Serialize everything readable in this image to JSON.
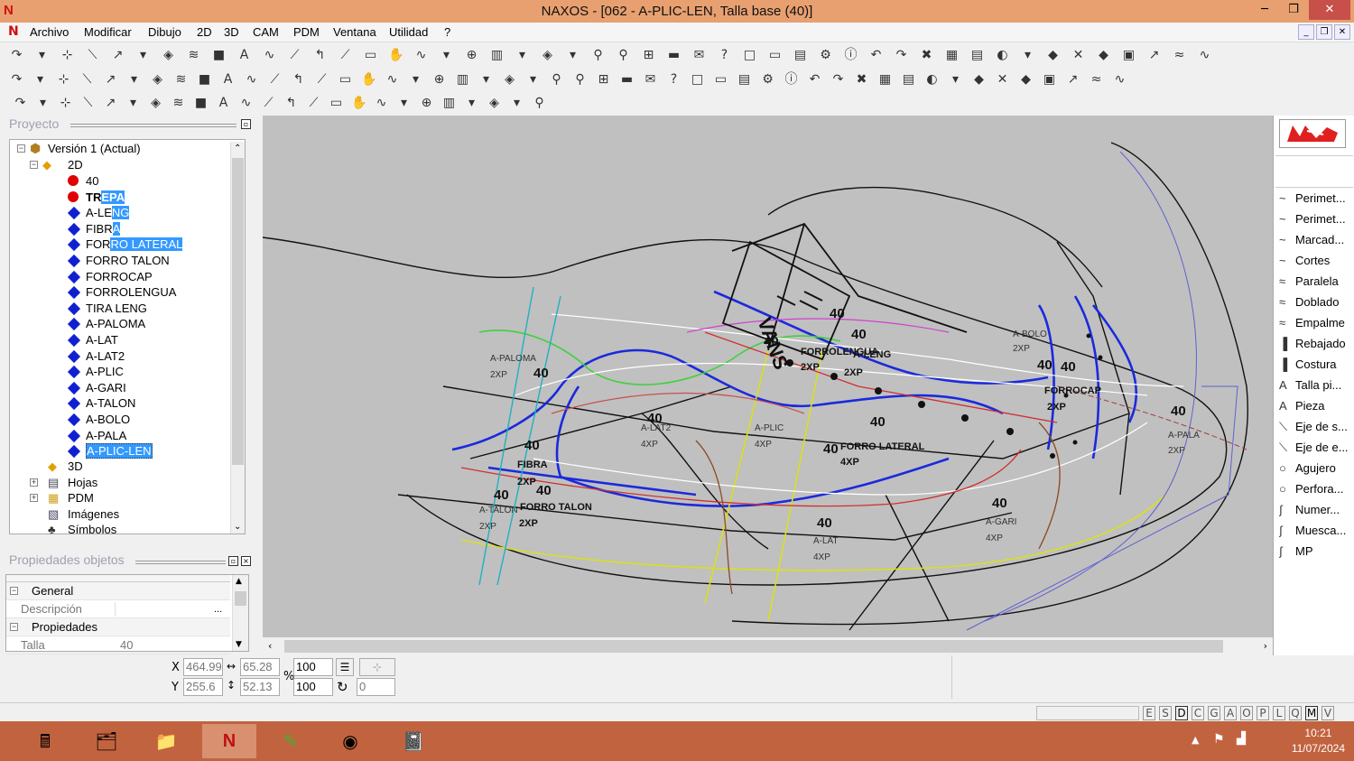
{
  "window": {
    "title": "NAXOS - [062 - A-PLIC-LEN, Talla base (40)]",
    "min": "─",
    "max": "❐",
    "close": "✕"
  },
  "menu": [
    "Archivo",
    "Modificar",
    "Dibujo",
    "2D",
    "3D",
    "CAM",
    "PDM",
    "Ventana",
    "Utilidad",
    "?"
  ],
  "project_panel": {
    "title": "Proyecto"
  },
  "tree": {
    "root": "Versión 1 (Actual)",
    "group_2d": "2D",
    "items": [
      {
        "label": "40",
        "marker": "red"
      },
      {
        "label": "TREPA",
        "marker": "red",
        "bold": true,
        "sel_from": 2
      },
      {
        "label": "A-LENG",
        "marker": "blue",
        "sel_from": 4
      },
      {
        "label": "FIBRA",
        "marker": "blue",
        "sel_from": 4
      },
      {
        "label": "FORRO LATERAL",
        "marker": "blue",
        "sel_from": 3
      },
      {
        "label": "FORRO TALON",
        "marker": "blue"
      },
      {
        "label": "FORROCAP",
        "marker": "blue"
      },
      {
        "label": "FORROLENGUA",
        "marker": "blue"
      },
      {
        "label": "TIRA LENG",
        "marker": "blue"
      },
      {
        "label": "A-PALOMA",
        "marker": "blue"
      },
      {
        "label": "A-LAT",
        "marker": "blue"
      },
      {
        "label": "A-LAT2",
        "marker": "blue"
      },
      {
        "label": "A-PLIC",
        "marker": "blue"
      },
      {
        "label": "A-GARI",
        "marker": "blue"
      },
      {
        "label": "A-TALON",
        "marker": "blue"
      },
      {
        "label": "A-BOLO",
        "marker": "blue"
      },
      {
        "label": "A-PALA",
        "marker": "blue"
      },
      {
        "label": "A-PLIC-LEN",
        "marker": "blue",
        "sel_from": 0
      }
    ],
    "bottom": [
      "3D",
      "Hojas",
      "PDM",
      "Imágenes",
      "Símbolos"
    ]
  },
  "props_panel": {
    "title": "Propiedades objetos",
    "general": "General",
    "descripcion_label": "Descripción",
    "descripcion_btn": "...",
    "propiedades": "Propiedades",
    "talla_label": "Talla",
    "talla_value": "40"
  },
  "right_panel": {
    "items": [
      "Perimet...",
      "Perimet...",
      "Marcad...",
      "Cortes",
      "Paralela",
      "Doblado",
      "Empalme",
      "Rebajado",
      "Costura",
      "Talla pi...",
      "Pieza",
      "Eje de s...",
      "Eje de e...",
      "Agujero",
      "Perfora...",
      "Numer...",
      "Muesca...",
      "MP"
    ],
    "icons": [
      "~",
      "~",
      "~",
      "~",
      "≈",
      "≈",
      "≈",
      "▐",
      "▐",
      "A",
      "A",
      "⟍",
      "⟍",
      "○",
      "○",
      "∫",
      "∫",
      "∫"
    ]
  },
  "coords": {
    "x_label": "X",
    "x": "464.99",
    "w": "65.28",
    "y_label": "Y",
    "y": "255.6",
    "h": "52.13",
    "pct_label": "%",
    "sx": "100",
    "sy": "100",
    "rot": "0"
  },
  "status_keys": [
    "E",
    "S",
    "D",
    "C",
    "G",
    "A",
    "O",
    "P",
    "L",
    "Q",
    "M",
    "V"
  ],
  "clock": {
    "time": "10:21",
    "date": "11/07/2024"
  },
  "canvas_labels": [
    {
      "t": "A-PALOMA",
      "k": "s"
    },
    {
      "t": "2XP",
      "k": "s"
    },
    {
      "t": "40",
      "k": "m"
    },
    {
      "t": "40",
      "k": "m"
    },
    {
      "t": "FORROLENGUA",
      "k": "b"
    },
    {
      "t": "A-LENG",
      "k": "b"
    },
    {
      "t": "2XP",
      "k": "b"
    },
    {
      "t": "2XP",
      "k": "b"
    },
    {
      "t": "40",
      "k": "m"
    },
    {
      "t": "40",
      "k": "m"
    },
    {
      "t": "A-BOLO",
      "k": "s"
    },
    {
      "t": "2XP",
      "k": "s"
    },
    {
      "t": "40",
      "k": "m"
    },
    {
      "t": "40",
      "k": "m"
    },
    {
      "t": "FORROCAP",
      "k": "b"
    },
    {
      "t": "2XP",
      "k": "b"
    },
    {
      "t": "40",
      "k": "m"
    },
    {
      "t": "A-PALA",
      "k": "s"
    },
    {
      "t": "2XP",
      "k": "s"
    },
    {
      "t": "40",
      "k": "m"
    },
    {
      "t": "A-LAT2",
      "k": "s"
    },
    {
      "t": "4XP",
      "k": "s"
    },
    {
      "t": "A-PLIC",
      "k": "s"
    },
    {
      "t": "4XP",
      "k": "s"
    },
    {
      "t": "40",
      "k": "m"
    },
    {
      "t": "40",
      "k": "m"
    },
    {
      "t": "FORRO LATERAL",
      "k": "b"
    },
    {
      "t": "4XP",
      "k": "b"
    },
    {
      "t": "40",
      "k": "m"
    },
    {
      "t": "FIBRA",
      "k": "b"
    },
    {
      "t": "2XP",
      "k": "b"
    },
    {
      "t": "40",
      "k": "m"
    },
    {
      "t": "40",
      "k": "m"
    },
    {
      "t": "A-TALON",
      "k": "s"
    },
    {
      "t": "2XP",
      "k": "s"
    },
    {
      "t": "FORRO TALON",
      "k": "b"
    },
    {
      "t": "2XP",
      "k": "b"
    },
    {
      "t": "40",
      "k": "m"
    },
    {
      "t": "A-LAT",
      "k": "s"
    },
    {
      "t": "4XP",
      "k": "s"
    },
    {
      "t": "40",
      "k": "m"
    },
    {
      "t": "A-GARI",
      "k": "s"
    },
    {
      "t": "4XP",
      "k": "s"
    },
    {
      "t": "VANS",
      "k": "logo"
    }
  ],
  "colors": {
    "titlebar": "#e8a070",
    "canvas": "#c0c0c0",
    "taskbar": "#c2633f",
    "selection": "#3399ff"
  }
}
